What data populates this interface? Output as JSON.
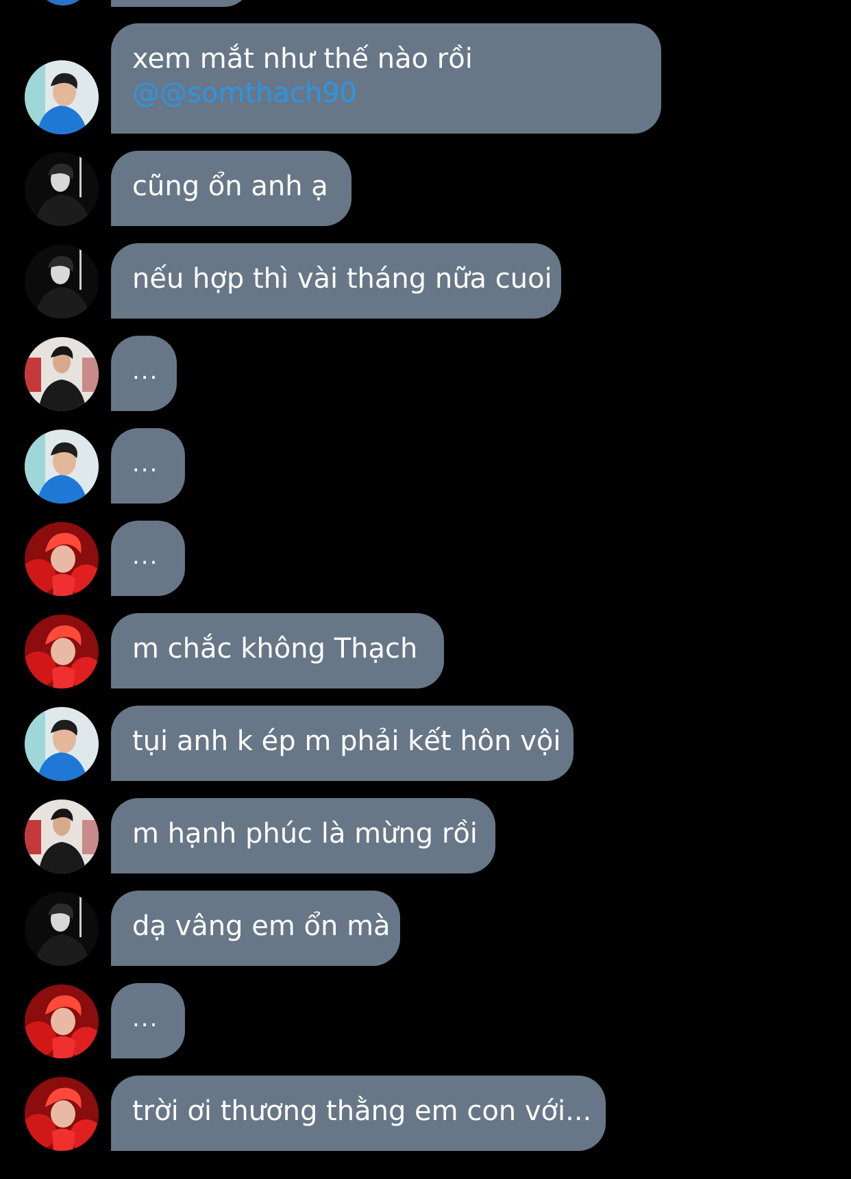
{
  "messages": [
    {
      "avatar": "avatar-user-blue-shirt",
      "text": "xem mắt như thế nào rồi",
      "mention": "@@somthach90"
    },
    {
      "avatar": "avatar-user-black-jacket-bw",
      "text": "cũng ổn anh ạ"
    },
    {
      "avatar": "avatar-user-black-jacket-bw",
      "text": "nếu hợp thì vài tháng nữa cuoi"
    },
    {
      "avatar": "avatar-user-leather-jacket",
      "text": "..."
    },
    {
      "avatar": "avatar-user-blue-shirt",
      "text": "..."
    },
    {
      "avatar": "avatar-user-red-hair",
      "text": "..."
    },
    {
      "avatar": "avatar-user-red-hair",
      "text": "m chắc không Thạch"
    },
    {
      "avatar": "avatar-user-blue-shirt",
      "text": "tụi anh k ép m phải kết hôn vội"
    },
    {
      "avatar": "avatar-user-leather-jacket",
      "text": "m hạnh phúc là mừng rồi"
    },
    {
      "avatar": "avatar-user-black-jacket-bw",
      "text": "dạ vâng em ổn mà"
    },
    {
      "avatar": "avatar-user-red-hair",
      "text": "..."
    },
    {
      "avatar": "avatar-user-red-hair",
      "text": "trời ơi thương thằng em con với..."
    }
  ],
  "colors": {
    "background": "#000000",
    "bubble": "#687787",
    "text": "#ffffff",
    "mention": "#2b96e6"
  }
}
